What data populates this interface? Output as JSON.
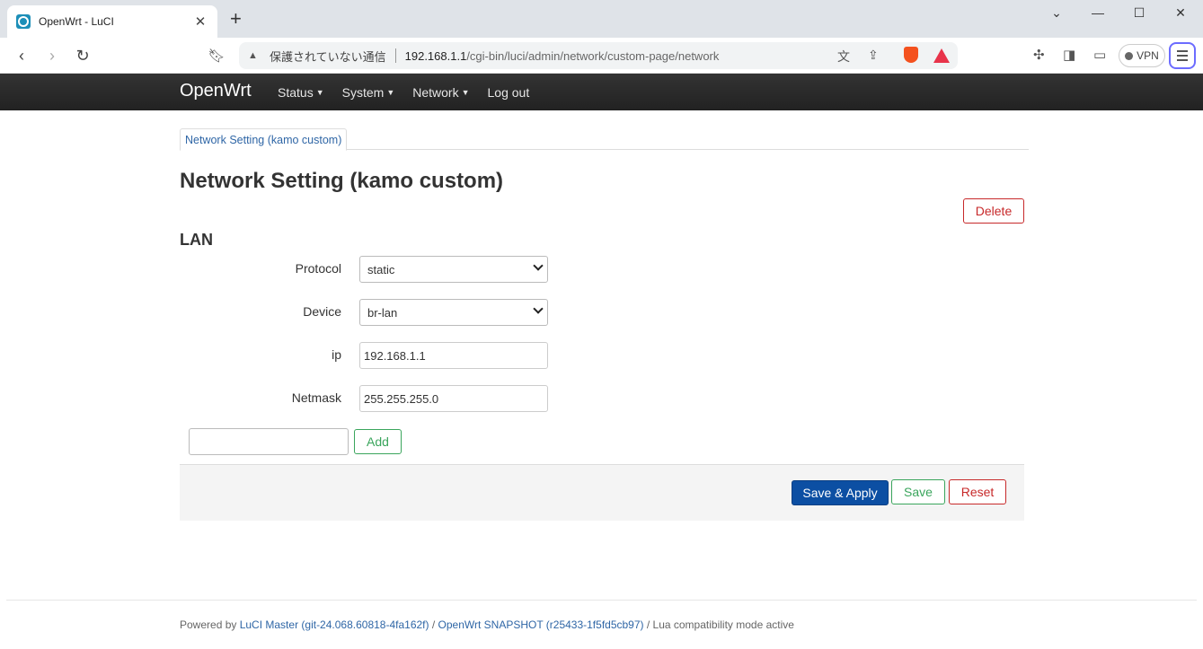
{
  "browser": {
    "tab_title": "OpenWrt - LuCI",
    "not_secure": "保護されていない通信",
    "url_host": "192.168.1.1",
    "url_path": "/cgi-bin/luci/admin/network/custom-page/network",
    "vpn_label": "VPN"
  },
  "header": {
    "brand": "OpenWrt",
    "menu": [
      {
        "label": "Status"
      },
      {
        "label": "System"
      },
      {
        "label": "Network"
      },
      {
        "label": "Log out"
      }
    ]
  },
  "tabs": [
    {
      "label": "Network Setting (kamo custom)"
    }
  ],
  "page": {
    "title": "Network Setting (kamo custom)",
    "delete_label": "Delete",
    "section_title": "LAN",
    "fields": {
      "protocol": {
        "label": "Protocol",
        "value": "static"
      },
      "device": {
        "label": "Device",
        "value": "br-lan"
      },
      "ip": {
        "label": "ip",
        "value": "192.168.1.1"
      },
      "netmask": {
        "label": "Netmask",
        "value": "255.255.255.0"
      }
    },
    "add_label": "Add"
  },
  "actions": {
    "save_apply": "Save & Apply",
    "save": "Save",
    "reset": "Reset"
  },
  "footer": {
    "powered_by": "Powered by ",
    "luci_link": "LuCI Master (git-24.068.60818-4fa162f)",
    "sep1": " / ",
    "openwrt_link": "OpenWrt SNAPSHOT (r25433-1f5fd5cb97)",
    "suffix": " / Lua compatibility mode active"
  }
}
